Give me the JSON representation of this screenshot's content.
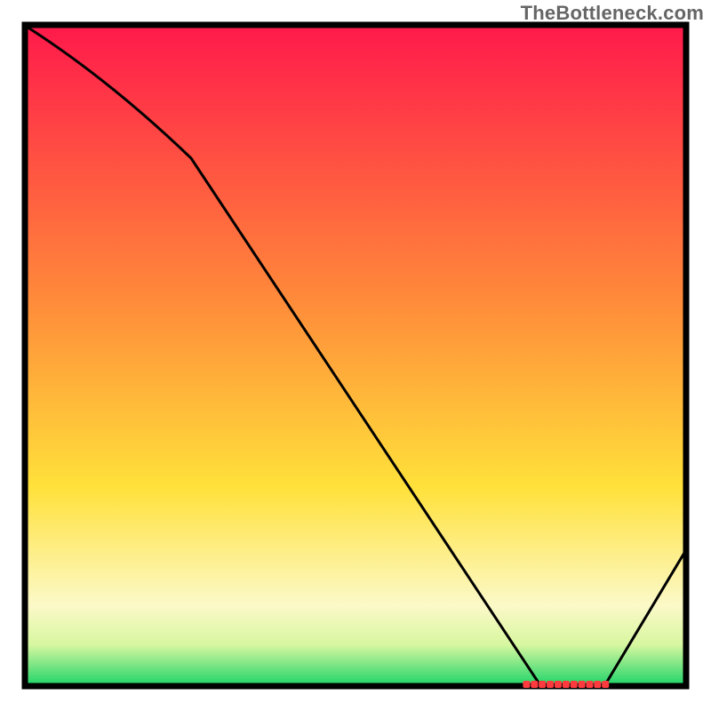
{
  "watermark": "TheBottleneck.com",
  "chart_data": {
    "type": "line",
    "title": "",
    "xlabel": "",
    "ylabel": "",
    "xlim": [
      0,
      100
    ],
    "ylim": [
      0,
      100
    ],
    "grid": false,
    "legend": false,
    "x": [
      0,
      25,
      78,
      88,
      100
    ],
    "values": [
      100,
      80,
      0,
      0,
      20
    ],
    "annotations": [
      {
        "type": "marker-strip",
        "x_start": 76,
        "x_end": 88,
        "y": 0,
        "color": "#ff3b3f"
      }
    ],
    "background_gradient": {
      "direction": "vertical",
      "stops": [
        {
          "pos": 0.0,
          "color": "#ff1a4b"
        },
        {
          "pos": 0.4,
          "color": "#ff863a"
        },
        {
          "pos": 0.7,
          "color": "#ffe13a"
        },
        {
          "pos": 0.88,
          "color": "#fcf9c8"
        },
        {
          "pos": 0.94,
          "color": "#d7f7a0"
        },
        {
          "pos": 1.0,
          "color": "#24d56a"
        }
      ]
    }
  }
}
